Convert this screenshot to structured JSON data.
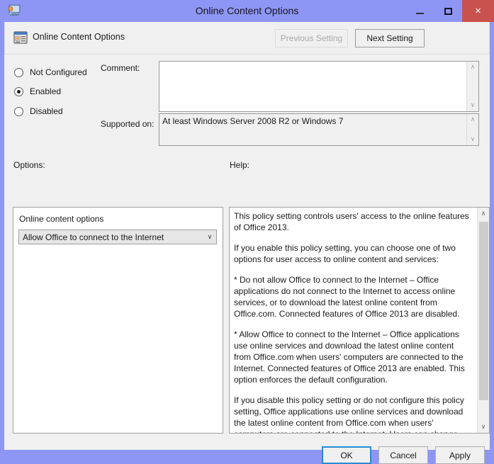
{
  "window": {
    "title": "Online Content Options",
    "title_icon": "policy-window-icon",
    "controls": {
      "minimize": "minimize-icon",
      "maximize": "maximize-icon",
      "close": "×"
    }
  },
  "header": {
    "icon": "policy-setting-icon",
    "title": "Online Content Options",
    "previous_setting": "Previous Setting",
    "next_setting": "Next Setting"
  },
  "state": {
    "options": [
      {
        "label": "Not Configured",
        "selected": false
      },
      {
        "label": "Enabled",
        "selected": true
      },
      {
        "label": "Disabled",
        "selected": false
      }
    ]
  },
  "comment": {
    "label": "Comment:",
    "value": "",
    "scroll_up": "∧",
    "scroll_down": "∨"
  },
  "supported_on": {
    "label": "Supported on:",
    "value": "At least Windows Server 2008 R2 or Windows 7",
    "scroll_up": "∧",
    "scroll_down": "∨"
  },
  "options_section": {
    "label": "Options:",
    "setting_label": "Online content options",
    "dropdown_value": "Allow Office to connect to the Internet",
    "dropdown_arrow": "∨"
  },
  "help_section": {
    "label": "Help:",
    "paragraphs": [
      "This policy setting controls users' access to the online features of Office 2013.",
      "If you enable this policy setting, you can choose one of two options for user access to online content and services:",
      "* Do not allow Office to connect to the Internet – Office applications do not connect to the Internet to access online services, or to download the latest online content from Office.com. Connected features of Office 2013 are disabled.",
      "* Allow Office to connect to the Internet – Office applications use online services and download the latest online content from Office.com when users' computers are connected to the Internet. Connected features of Office 2013 are enabled. This option enforces the default configuration.",
      "If you disable this policy setting or do not configure this policy setting, Office applications use online services and download the latest online content from Office.com when users' computers are connected to the Internet. Users can change this behavior by"
    ],
    "scroll_up": "∧",
    "scroll_down": "∨"
  },
  "footer": {
    "ok": "OK",
    "cancel": "Cancel",
    "apply": "Apply"
  },
  "colors": {
    "window_frame": "#8e96f5",
    "client_background": "#f0f0f0",
    "close_button": "#c9524f",
    "focus_border": "#2a8ad4",
    "scrollbar_thumb": "#cdcdcd"
  }
}
